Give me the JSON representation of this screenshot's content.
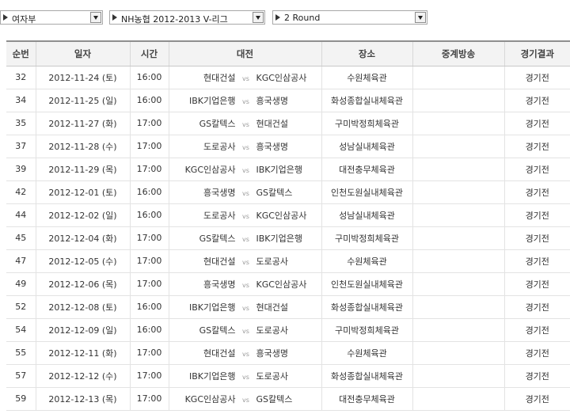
{
  "filters": [
    {
      "name": "gender-select",
      "value": "여자부"
    },
    {
      "name": "league-select",
      "value": "NH농협 2012-2013 V-리그"
    },
    {
      "name": "round-select",
      "value": "2 Round"
    }
  ],
  "table": {
    "headers": [
      "순번",
      "일자",
      "시간",
      "대전",
      "장소",
      "중계방송",
      "경기결과"
    ],
    "vs": "vs",
    "rows": [
      {
        "no": "32",
        "date": "2012-11-24 (토)",
        "time": "16:00",
        "home": "현대건설",
        "away": "KGC인삼공사",
        "venue": "수원체육관",
        "broadcast": "",
        "result": "경기전"
      },
      {
        "no": "34",
        "date": "2012-11-25 (일)",
        "time": "16:00",
        "home": "IBK기업은행",
        "away": "흥국생명",
        "venue": "화성종합실내체육관",
        "broadcast": "",
        "result": "경기전"
      },
      {
        "no": "35",
        "date": "2012-11-27 (화)",
        "time": "17:00",
        "home": "GS칼텍스",
        "away": "현대건설",
        "venue": "구미박정희체육관",
        "broadcast": "",
        "result": "경기전"
      },
      {
        "no": "37",
        "date": "2012-11-28 (수)",
        "time": "17:00",
        "home": "도로공사",
        "away": "흥국생명",
        "venue": "성남실내체육관",
        "broadcast": "",
        "result": "경기전"
      },
      {
        "no": "39",
        "date": "2012-11-29 (목)",
        "time": "17:00",
        "home": "KGC인삼공사",
        "away": "IBK기업은행",
        "venue": "대전충무체육관",
        "broadcast": "",
        "result": "경기전"
      },
      {
        "no": "42",
        "date": "2012-12-01 (토)",
        "time": "16:00",
        "home": "흥국생명",
        "away": "GS칼텍스",
        "venue": "인천도원실내체육관",
        "broadcast": "",
        "result": "경기전"
      },
      {
        "no": "44",
        "date": "2012-12-02 (일)",
        "time": "16:00",
        "home": "도로공사",
        "away": "KGC인삼공사",
        "venue": "성남실내체육관",
        "broadcast": "",
        "result": "경기전"
      },
      {
        "no": "45",
        "date": "2012-12-04 (화)",
        "time": "17:00",
        "home": "GS칼텍스",
        "away": "IBK기업은행",
        "venue": "구미박정희체육관",
        "broadcast": "",
        "result": "경기전"
      },
      {
        "no": "47",
        "date": "2012-12-05 (수)",
        "time": "17:00",
        "home": "현대건설",
        "away": "도로공사",
        "venue": "수원체육관",
        "broadcast": "",
        "result": "경기전"
      },
      {
        "no": "49",
        "date": "2012-12-06 (목)",
        "time": "17:00",
        "home": "흥국생명",
        "away": "KGC인삼공사",
        "venue": "인천도원실내체육관",
        "broadcast": "",
        "result": "경기전"
      },
      {
        "no": "52",
        "date": "2012-12-08 (토)",
        "time": "16:00",
        "home": "IBK기업은행",
        "away": "현대건설",
        "venue": "화성종합실내체육관",
        "broadcast": "",
        "result": "경기전"
      },
      {
        "no": "54",
        "date": "2012-12-09 (일)",
        "time": "16:00",
        "home": "GS칼텍스",
        "away": "도로공사",
        "venue": "구미박정희체육관",
        "broadcast": "",
        "result": "경기전"
      },
      {
        "no": "55",
        "date": "2012-12-11 (화)",
        "time": "17:00",
        "home": "현대건설",
        "away": "흥국생명",
        "venue": "수원체육관",
        "broadcast": "",
        "result": "경기전"
      },
      {
        "no": "57",
        "date": "2012-12-12 (수)",
        "time": "17:00",
        "home": "IBK기업은행",
        "away": "도로공사",
        "venue": "화성종합실내체육관",
        "broadcast": "",
        "result": "경기전"
      },
      {
        "no": "59",
        "date": "2012-12-13 (목)",
        "time": "17:00",
        "home": "KGC인삼공사",
        "away": "GS칼텍스",
        "venue": "대전충무체육관",
        "broadcast": "",
        "result": "경기전"
      }
    ]
  }
}
